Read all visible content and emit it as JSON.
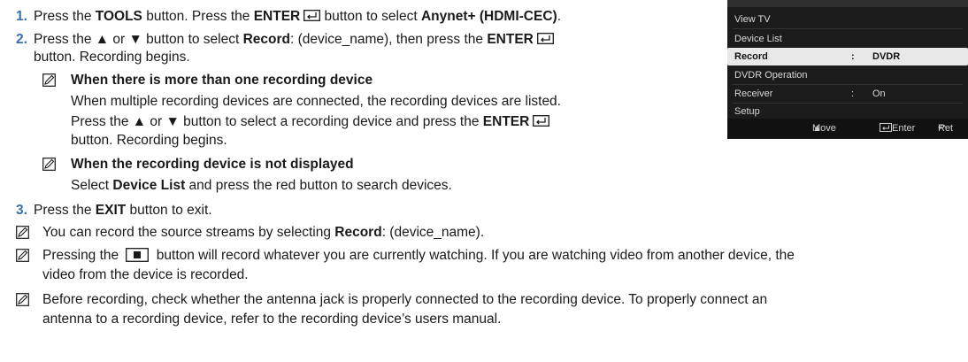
{
  "step1": {
    "num": "1.",
    "t1": "Press the ",
    "b1": "TOOLS",
    "t2": " button. Press the ",
    "b2": "ENTER",
    "t3": " button to select ",
    "b3": "Anynet+ (HDMI-CEC)",
    "t4": "."
  },
  "step2": {
    "num": "2.",
    "t1": "Press the ▲ or ▼ button to select ",
    "b1": "Record",
    "t2": ": (device_name), then press the ",
    "b2": "ENTER",
    "line2": "button. Recording begins."
  },
  "note1": {
    "heading": "When there is more than one recording device",
    "l1": "When multiple recording devices are connected, the recording devices are listed.",
    "l2a": "Press the ▲ or ▼ button to select a recording device and press the ",
    "l2b": "ENTER",
    "l3": "button. Recording begins."
  },
  "note2": {
    "heading": "When the recording device is not displayed",
    "t1": "Select ",
    "b1": "Device List",
    "t2": " and press the red button to search devices."
  },
  "step3": {
    "num": "3.",
    "t1": "Press the ",
    "b1": "EXIT",
    "t2": " button to exit."
  },
  "tip1": {
    "t1": "You can record the source streams by selecting ",
    "b1": "Record",
    "t2": ": (device_name)."
  },
  "tip2": {
    "t1": "Pressing the ",
    "t2": " button will record whatever you are currently watching. If you are watching video from another device, the",
    "l2": "video from the device is recorded."
  },
  "tip3": {
    "l1": "Before recording, check whether the antenna jack is properly connected to the recording device. To properly connect an",
    "l2": "antenna to a recording device, refer to the recording device’s users manual."
  },
  "osd": {
    "items": [
      {
        "label": "View TV",
        "sep": "",
        "value": ""
      },
      {
        "label": "Device List",
        "sep": "",
        "value": ""
      },
      {
        "label": "Record",
        "sep": ":",
        "value": "DVDR"
      },
      {
        "label": "DVDR Operation",
        "sep": "",
        "value": ""
      },
      {
        "label": "Receiver",
        "sep": ":",
        "value": "On"
      },
      {
        "label": "Setup",
        "sep": "",
        "value": ""
      }
    ],
    "footer": {
      "move": "Move",
      "enter": "Enter",
      "return": "Ret"
    },
    "colors": {
      "background": "#1b1b1b",
      "selected": "#e8e8e8",
      "step_number": "#3a6fb0"
    }
  }
}
